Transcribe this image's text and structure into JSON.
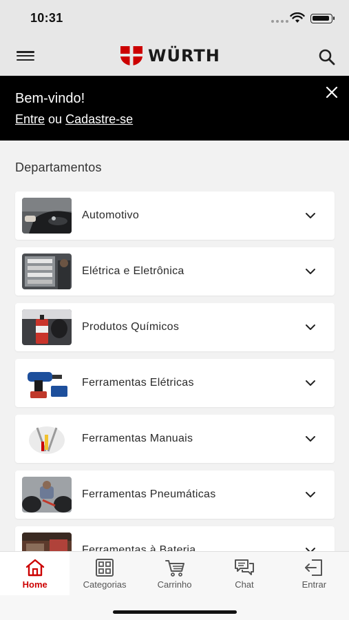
{
  "status_bar": {
    "time": "10:31"
  },
  "header": {
    "brand": "WÜRTH",
    "logo_color": "#cc0000"
  },
  "banner": {
    "greeting": "Bem-vindo!",
    "login_link": "Entre",
    "separator": "ou",
    "signup_link": "Cadastre-se"
  },
  "departments": {
    "title": "Departamentos",
    "items": [
      {
        "label": "Automotivo",
        "thumb_icon": "car-photo-icon"
      },
      {
        "label": "Elétrica e Eletrônica",
        "thumb_icon": "electrical-panel-photo-icon"
      },
      {
        "label": "Produtos Químicos",
        "thumb_icon": "spray-can-photo-icon"
      },
      {
        "label": "Ferramentas Elétricas",
        "thumb_icon": "power-drill-photo-icon"
      },
      {
        "label": "Ferramentas Manuais",
        "thumb_icon": "hand-tools-photo-icon"
      },
      {
        "label": "Ferramentas Pneumáticas",
        "thumb_icon": "pneumatic-tool-photo-icon"
      },
      {
        "label": "Ferramentas à Bateria",
        "thumb_icon": "battery-tool-photo-icon"
      }
    ]
  },
  "bottom_nav": {
    "items": [
      {
        "label": "Home",
        "icon": "home-icon",
        "active": true
      },
      {
        "label": "Categorias",
        "icon": "grid-icon",
        "active": false
      },
      {
        "label": "Carrinho",
        "icon": "cart-icon",
        "active": false
      },
      {
        "label": "Chat",
        "icon": "chat-icon",
        "active": false
      },
      {
        "label": "Entrar",
        "icon": "login-icon",
        "active": false
      }
    ]
  },
  "colors": {
    "accent": "#cc0000",
    "banner_bg": "#000000",
    "header_bg": "#e7e7e7"
  }
}
